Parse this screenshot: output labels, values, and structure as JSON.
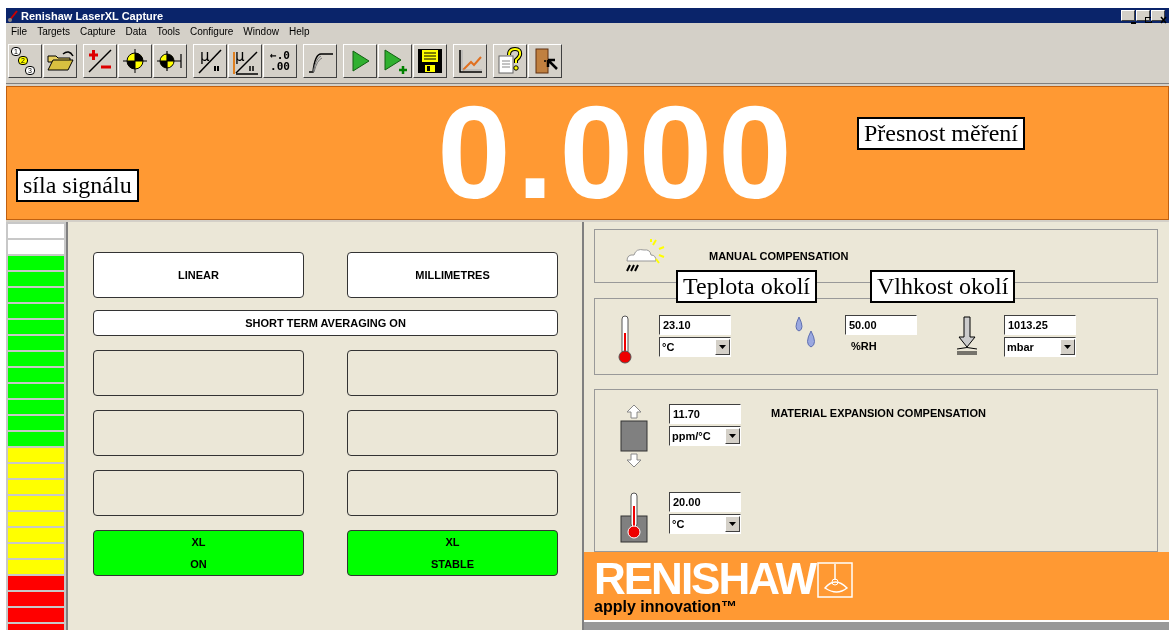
{
  "window": {
    "title": "Renishaw LaserXL Capture"
  },
  "menu": [
    "File",
    "Targets",
    "Capture",
    "Data",
    "Tools",
    "Configure",
    "Window",
    "Help"
  ],
  "toolbar": [
    [
      {
        "kind": "numbers",
        "lines": [
          "1",
          "2",
          "3"
        ]
      },
      {
        "kind": "folder"
      }
    ],
    [
      {
        "kind": "sign"
      },
      {
        "kind": "target"
      },
      {
        "kind": "targetend"
      }
    ],
    [
      {
        "kind": "mu",
        "label": "μ"
      },
      {
        "kind": "muaxis",
        "label": "μ"
      },
      {
        "kind": "digits",
        "lines": [
          "←.0",
          ".00"
        ]
      }
    ],
    [
      {
        "kind": "curve"
      }
    ],
    [
      {
        "kind": "play"
      },
      {
        "kind": "playadd"
      },
      {
        "kind": "disk"
      }
    ],
    [
      {
        "kind": "chart"
      }
    ],
    [
      {
        "kind": "help"
      },
      {
        "kind": "door"
      }
    ]
  ],
  "reading": {
    "value": "0.000"
  },
  "signal_meter": {
    "segments": [
      {
        "color": "#ffffff"
      },
      {
        "color": "#ffffff"
      },
      {
        "color": "#00ff00"
      },
      {
        "color": "#00ff00"
      },
      {
        "color": "#00ff00"
      },
      {
        "color": "#00ff00"
      },
      {
        "color": "#00ff00"
      },
      {
        "color": "#00ff00"
      },
      {
        "color": "#00ff00"
      },
      {
        "color": "#00ff00"
      },
      {
        "color": "#00ff00"
      },
      {
        "color": "#00ff00"
      },
      {
        "color": "#00ff00"
      },
      {
        "color": "#00ff00"
      },
      {
        "color": "#ffff00"
      },
      {
        "color": "#ffff00"
      },
      {
        "color": "#ffff00"
      },
      {
        "color": "#ffff00"
      },
      {
        "color": "#ffff00"
      },
      {
        "color": "#ffff00"
      },
      {
        "color": "#ffff00"
      },
      {
        "color": "#ffff00"
      },
      {
        "color": "#ff0000"
      },
      {
        "color": "#ff0000"
      },
      {
        "color": "#ff0000"
      },
      {
        "color": "#ff0000"
      }
    ]
  },
  "mode_buttons": [
    {
      "kind": "label",
      "text": "LINEAR"
    },
    {
      "kind": "label",
      "text": "MILLIMETRES"
    },
    {
      "kind": "wide",
      "text": "SHORT TERM AVERAGING ON"
    },
    {
      "kind": "blank"
    },
    {
      "kind": "blank"
    },
    {
      "kind": "blank"
    },
    {
      "kind": "blank"
    },
    {
      "kind": "blank"
    },
    {
      "kind": "blank"
    },
    {
      "kind": "status",
      "lines": [
        "XL",
        "ON"
      ]
    },
    {
      "kind": "status",
      "lines": [
        "XL",
        "STABLE"
      ]
    }
  ],
  "compensation": {
    "title": "MANUAL COMPENSATION"
  },
  "environment": [
    {
      "kind": "select",
      "value": "23.10",
      "unit": "°C"
    },
    {
      "kind": "label",
      "value": "50.00",
      "unit": "%RH"
    },
    {
      "kind": "select",
      "value": "1013.25",
      "unit": "mbar"
    }
  ],
  "material": {
    "title": "MATERIAL EXPANSION COMPENSATION",
    "fields": [
      {
        "value": "11.70",
        "unit": "ppm/°C"
      },
      {
        "value": "20.00",
        "unit": "°C"
      }
    ]
  },
  "logo": {
    "brand": "RENISHAW",
    "tagline": "apply innovation™"
  },
  "annotations": [
    {
      "text": "síla signálu"
    },
    {
      "text": "Přesnost měření"
    },
    {
      "text": "Teplota okolí"
    },
    {
      "text": "Vlhkost okolí"
    }
  ]
}
